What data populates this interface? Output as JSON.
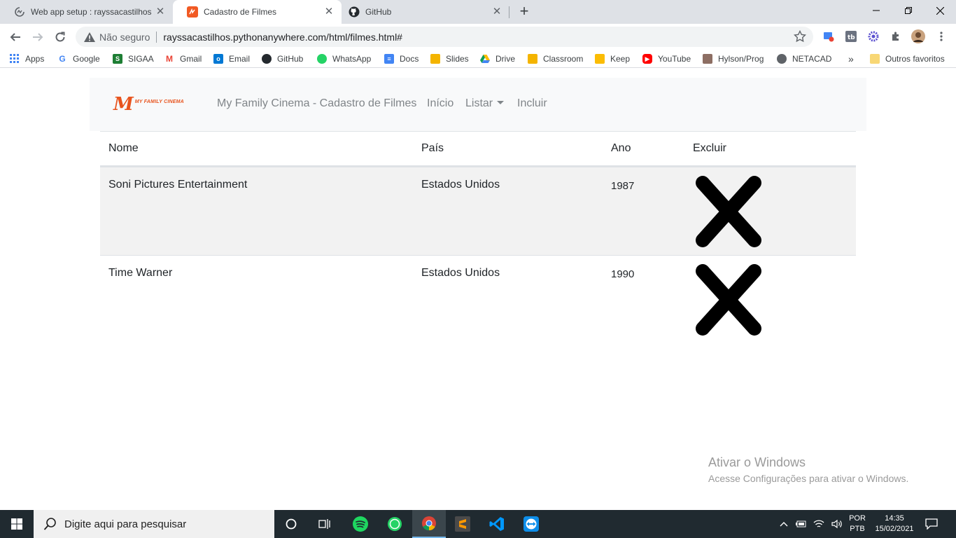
{
  "browser": {
    "tabs": [
      {
        "title": "Web app setup : rayssacastilhos :",
        "close": "✕"
      },
      {
        "title": "Cadastro de Filmes",
        "close": "✕"
      },
      {
        "title": "GitHub",
        "close": "✕"
      }
    ],
    "new_tab": "+",
    "omnibox": {
      "security_text": "Não seguro",
      "url": "rayssacastilhos.pythonanywhere.com/html/filmes.html#"
    },
    "bookmarks": [
      {
        "label": "Apps",
        "color": "#4285f4"
      },
      {
        "label": "Google",
        "color": "#4285f4"
      },
      {
        "label": "SIGAA",
        "color": "#1e7e34"
      },
      {
        "label": "Gmail",
        "color": "#ea4335"
      },
      {
        "label": "Email",
        "color": "#0078d4"
      },
      {
        "label": "GitHub",
        "color": "#24292e"
      },
      {
        "label": "WhatsApp",
        "color": "#25d366"
      },
      {
        "label": "Docs",
        "color": "#4285f4"
      },
      {
        "label": "Slides",
        "color": "#f4b400"
      },
      {
        "label": "Drive",
        "color": "#0f9d58"
      },
      {
        "label": "Classroom",
        "color": "#f4b400"
      },
      {
        "label": "Keep",
        "color": "#fbbc04"
      },
      {
        "label": "YouTube",
        "color": "#ff0000"
      },
      {
        "label": "Hylson/Prog",
        "color": "#8d6e63"
      },
      {
        "label": "NETACAD",
        "color": "#5f6368"
      }
    ],
    "bookmarks_more": "»",
    "other_favorites": "Outros favoritos"
  },
  "site": {
    "brand_text": "MY FAMILY CINEMA",
    "nav": {
      "title": "My Family Cinema - Cadastro de Filmes",
      "home": "Início",
      "list": "Listar",
      "add": "Incluir"
    },
    "table": {
      "headers": {
        "name": "Nome",
        "country": "País",
        "year": "Ano",
        "delete": "Excluir"
      },
      "rows": [
        {
          "name": "Soni Pictures Entertainment",
          "country": "Estados Unidos",
          "year": "1987"
        },
        {
          "name": "Time Warner",
          "country": "Estados Unidos",
          "year": "1990"
        }
      ]
    }
  },
  "watermark": {
    "title": "Ativar o Windows",
    "subtitle": "Acesse Configurações para ativar o Windows."
  },
  "taskbar": {
    "search_placeholder": "Digite aqui para pesquisar",
    "lang_top": "POR",
    "lang_bottom": "PTB",
    "time": "14:35",
    "date": "15/02/2021"
  }
}
